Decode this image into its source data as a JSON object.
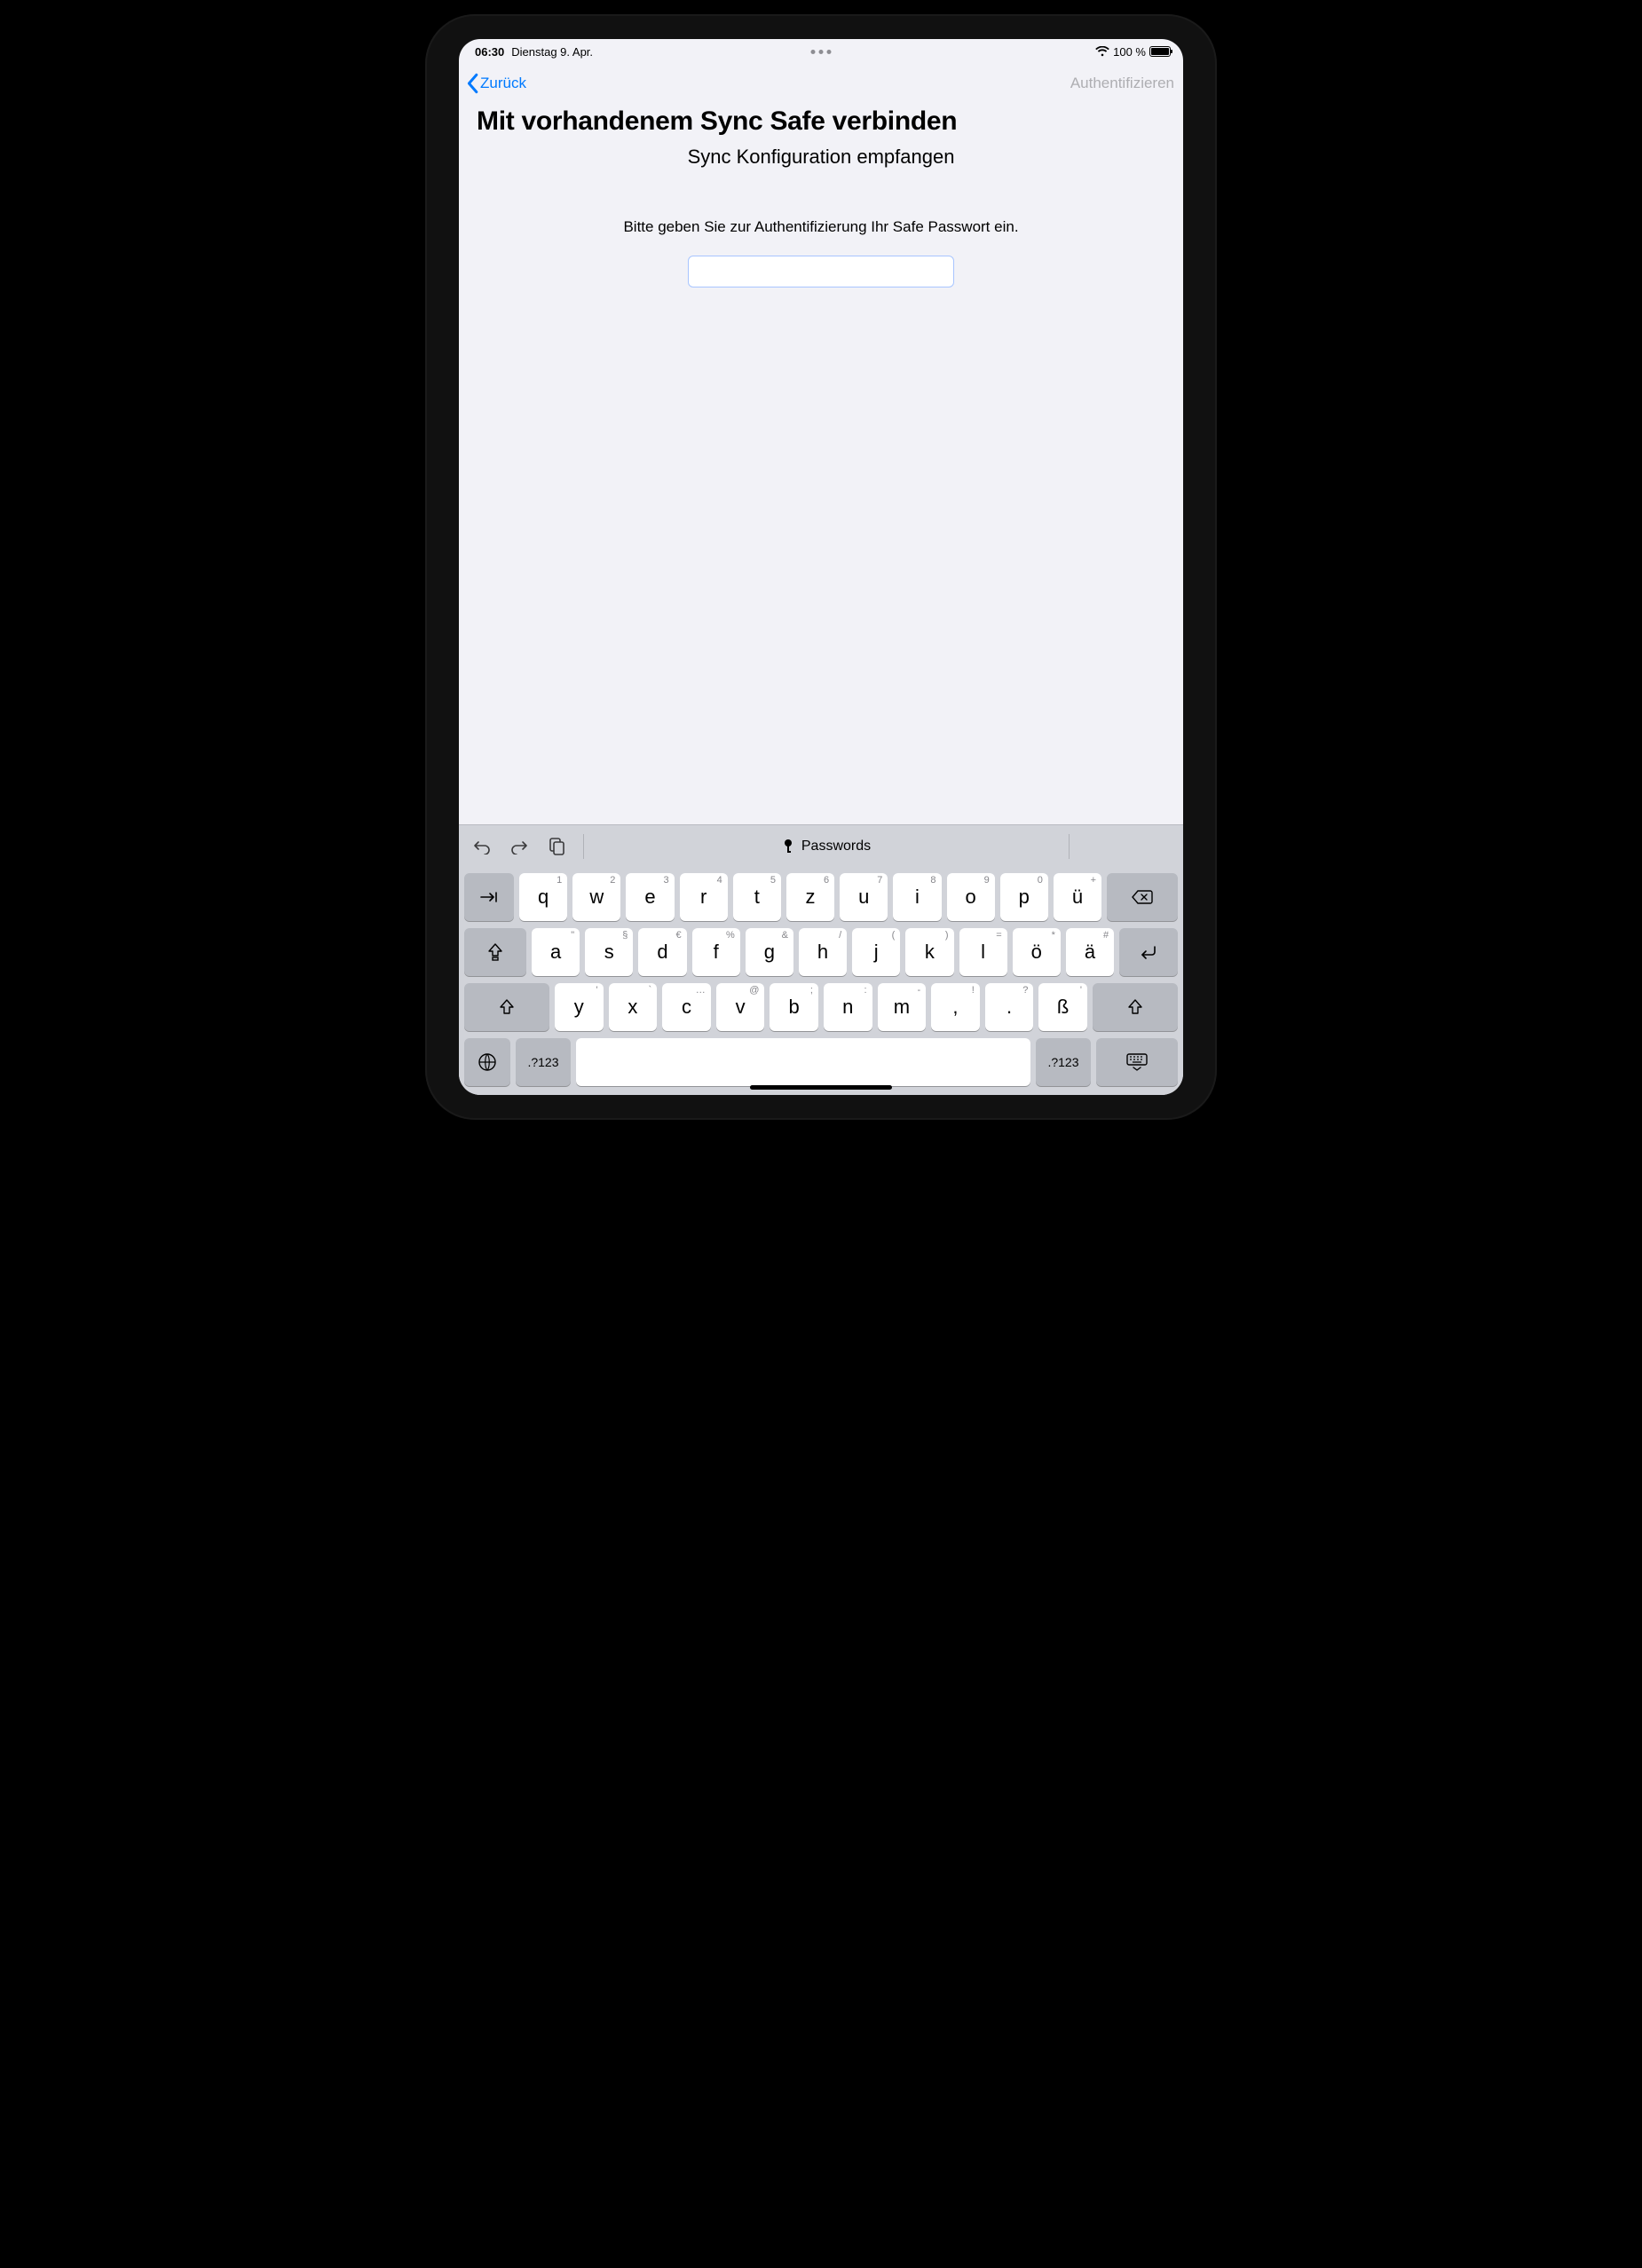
{
  "statusBar": {
    "time": "06:30",
    "date": "Dienstag 9. Apr.",
    "batteryPercent": "100 %"
  },
  "nav": {
    "backLabel": "Zurück",
    "rightLabel": "Authentifizieren"
  },
  "page": {
    "title": "Mit vorhandenem Sync Safe verbinden",
    "subtitle": "Sync Konfiguration empfangen",
    "prompt": "Bitte geben Sie zur Authentifizierung Ihr Safe Passwort ein.",
    "passwordValue": ""
  },
  "keyboard": {
    "passwordsLabel": "Passwords",
    "numSymLabel": ".?123",
    "row1": [
      {
        "alt": "1",
        "main": "q"
      },
      {
        "alt": "2",
        "main": "w"
      },
      {
        "alt": "3",
        "main": "e"
      },
      {
        "alt": "4",
        "main": "r"
      },
      {
        "alt": "5",
        "main": "t"
      },
      {
        "alt": "6",
        "main": "z"
      },
      {
        "alt": "7",
        "main": "u"
      },
      {
        "alt": "8",
        "main": "i"
      },
      {
        "alt": "9",
        "main": "o"
      },
      {
        "alt": "0",
        "main": "p"
      },
      {
        "alt": "+",
        "main": "ü"
      }
    ],
    "row2": [
      {
        "alt": "\"",
        "main": "a"
      },
      {
        "alt": "§",
        "main": "s"
      },
      {
        "alt": "€",
        "main": "d"
      },
      {
        "alt": "%",
        "main": "f"
      },
      {
        "alt": "&",
        "main": "g"
      },
      {
        "alt": "/",
        "main": "h"
      },
      {
        "alt": "(",
        "main": "j"
      },
      {
        "alt": ")",
        "main": "k"
      },
      {
        "alt": "=",
        "main": "l"
      },
      {
        "alt": "*",
        "main": "ö"
      },
      {
        "alt": "#",
        "main": "ä"
      }
    ],
    "row3": [
      {
        "alt": "'",
        "main": "y"
      },
      {
        "alt": "`",
        "main": "x"
      },
      {
        "alt": "…",
        "main": "c"
      },
      {
        "alt": "@",
        "main": "v"
      },
      {
        "alt": ";",
        "main": "b"
      },
      {
        "alt": ":",
        "main": "n"
      },
      {
        "alt": "-",
        "main": "m"
      },
      {
        "alt": "!",
        "main": ","
      },
      {
        "alt": "?",
        "main": "."
      },
      {
        "alt": "'",
        "main": "ß"
      }
    ]
  }
}
